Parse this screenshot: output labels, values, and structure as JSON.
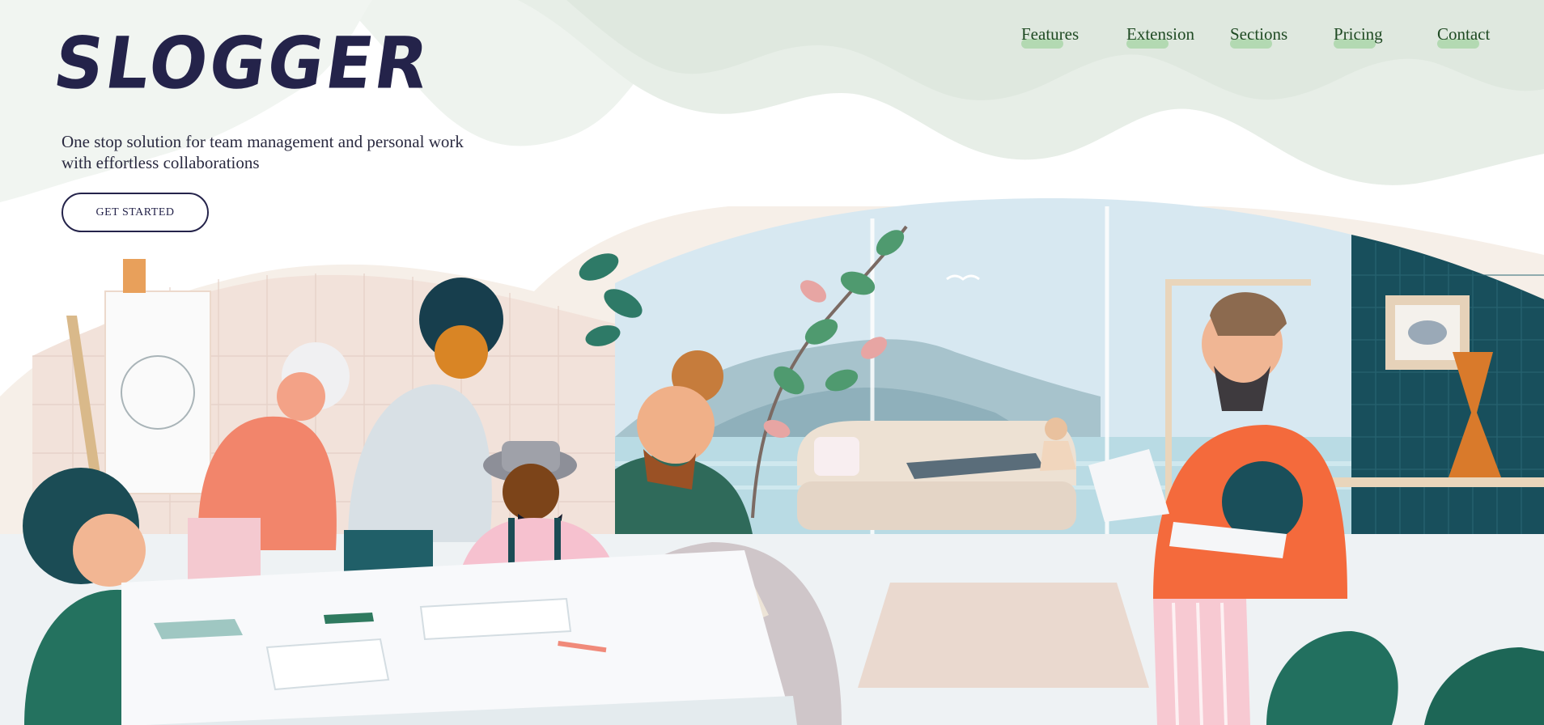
{
  "header": {
    "logo_text": "SLOGGER",
    "nav": [
      {
        "label": "Features"
      },
      {
        "label": "Extension"
      },
      {
        "label": "Sections"
      },
      {
        "label": "Pricing"
      },
      {
        "label": "Contact"
      }
    ]
  },
  "hero": {
    "tagline": "One stop solution for team management and personal work with effortless collaborations",
    "cta_label": "GET STARTED"
  },
  "colors": {
    "brand_navy": "#24234a",
    "nav_text": "#1f4a23",
    "nav_highlight": "#b3d9b2",
    "wave_green": "#e3ece3"
  },
  "illustration": {
    "icon": "team-collaboration-illustration"
  }
}
